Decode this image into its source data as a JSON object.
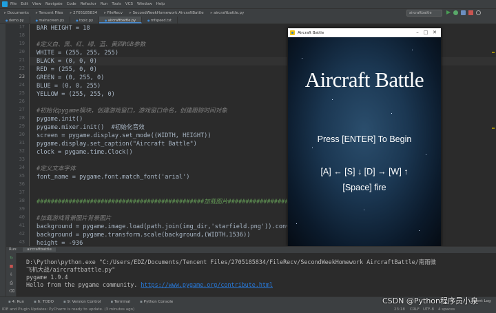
{
  "menubar": {
    "items": [
      "File",
      "Edit",
      "View",
      "Navigate",
      "Code",
      "Refactor",
      "Run",
      "Tools",
      "VCS",
      "Window",
      "Help"
    ]
  },
  "navbar": {
    "crumbs": [
      "Documents",
      "Tencent Files",
      "2705185834",
      "FileRecv",
      "SecondWeekHomework AircraftBattle",
      "aircraftbattle.py"
    ],
    "run_config": "aircraftbattle"
  },
  "tabs": [
    "demo.py",
    "mainscreen.py",
    "topic.py",
    "aircraftbattle.py",
    "mfspeed.txt"
  ],
  "editor": {
    "line_numbers": [
      "17",
      "18",
      "19",
      "20",
      "21",
      "22",
      "23",
      "24",
      "25",
      "26",
      "27",
      "28",
      "29",
      "30",
      "31",
      "32",
      "33",
      "34",
      "35",
      "36",
      "37",
      "38",
      "39",
      "40",
      "41",
      "42",
      "43",
      "44"
    ],
    "current_line": "23",
    "lines": [
      "BAR HEIGHT = 18",
      "",
      "#定义白、黑、红、绿、蓝、黄四RGB参数",
      "WHITE = (255, 255, 255)",
      "BLACK = (0, 0, 0)",
      "RED = (255, 0, 0)",
      "GREEN = (0, 255, 0)",
      "BLUE = (0, 0, 255)",
      "YELLOW = (255, 255, 0)",
      "",
      "#初始化pygame模块，创建游戏窗口，游戏窗口命名，创建跟踪时间对象",
      "pygame.init()",
      "pygame.mixer.init()  #初始化音效",
      "screen = pygame.display.set_mode((WIDTH, HEIGHT))",
      "pygame.display.set_caption(\"Aircraft Battle\")",
      "clock = pygame.time.Clock()",
      "",
      "#定义文本字体",
      "font_name = pygame.font.match_font('arial')",
      "",
      "",
      "###############################################加载图片################################################",
      "",
      "#加载游戏背景图片背景图片",
      "background = pygame.image.load(path.join(img_dir,'starfield.png')).convert()",
      "background = pygame.transform.scale(background,(WIDTH,1536))",
      "height = -936",
      ""
    ]
  },
  "game_window": {
    "title": "Aircraft Battle",
    "heading": "Aircraft Battle",
    "prompt": "Press [ENTER] To Begin",
    "controls": "[A] ←  [S] ↓  [D] →  [W] ↑",
    "fire": "[Space] fire"
  },
  "run_panel": {
    "label": "Run:",
    "tab": "aircraftbattle",
    "console": [
      "D:\\Python\\python.exe \"C:/Users/EDZ/Documents/Tencent Files/2705185834/FileRecv/SecondWeekHomework AircraftBattle/南雨微",
      "飞机大战/aircraftbattle.py\"",
      "pygame 1.9.4",
      "Hello from the pygame community. "
    ],
    "link": "https://www.pygame.org/contribute.html"
  },
  "tool_tabs": [
    "4: Run",
    "6: TODO",
    "9: Version Control",
    "Terminal",
    "Python Console"
  ],
  "event_log": "Event Log",
  "status": {
    "message": "IDE and Plugin Updates: PyCharm is ready to update. (3 minutes ago)",
    "position": "23:18",
    "line_sep": "CRLF",
    "encoding": "UTF-8",
    "indent": "4 spaces"
  },
  "watermark": "CSDN @Python程序员小泉",
  "colors": {
    "editor_bg": "#2b2b2b",
    "chrome": "#3c3f41",
    "comment": "#808080",
    "link": "#287bde",
    "game_bg": "#1b3752"
  }
}
